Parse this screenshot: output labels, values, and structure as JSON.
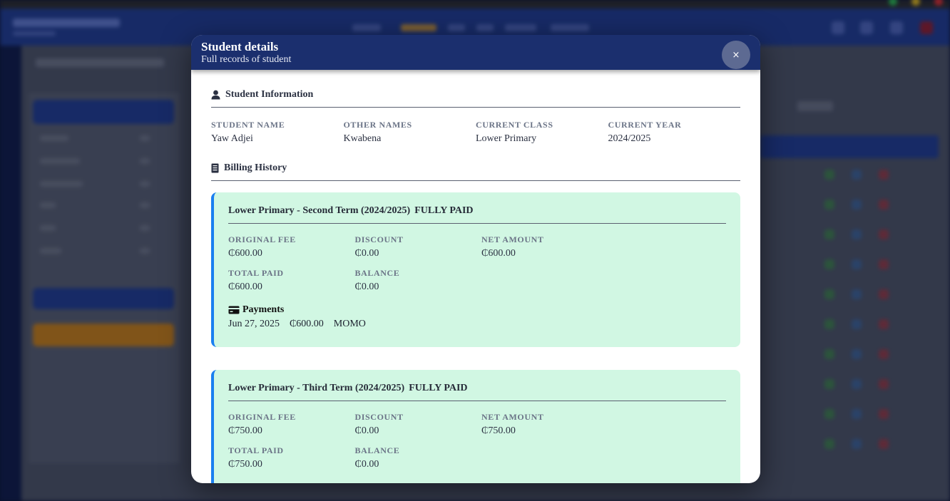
{
  "modal": {
    "title": "Student details",
    "subtitle": "Full records of student",
    "close_label": "×"
  },
  "student_info": {
    "heading": "Student Information",
    "fields": [
      {
        "label": "STUDENT NAME",
        "value": "Yaw Adjei"
      },
      {
        "label": "OTHER NAMES",
        "value": "Kwabena"
      },
      {
        "label": "CURRENT CLASS",
        "value": "Lower Primary"
      },
      {
        "label": "CURRENT YEAR",
        "value": "2024/2025"
      }
    ]
  },
  "billing": {
    "heading": "Billing History",
    "records": [
      {
        "title": "Lower Primary - Second Term (2024/2025)",
        "status": "FULLY PAID",
        "fields": [
          {
            "label": "ORIGINAL FEE",
            "value": "₵600.00"
          },
          {
            "label": "DISCOUNT",
            "value": "₵0.00"
          },
          {
            "label": "NET AMOUNT",
            "value": "₵600.00"
          },
          {
            "label": "TOTAL PAID",
            "value": "₵600.00"
          },
          {
            "label": "BALANCE",
            "value": "₵0.00"
          }
        ],
        "payments_heading": "Payments",
        "payments": [
          {
            "date": "Jun 27, 2025",
            "amount": "₵600.00",
            "method": "MOMO"
          }
        ]
      },
      {
        "title": "Lower Primary - Third Term (2024/2025)",
        "status": "FULLY PAID",
        "fields": [
          {
            "label": "ORIGINAL FEE",
            "value": "₵750.00"
          },
          {
            "label": "DISCOUNT",
            "value": "₵0.00"
          },
          {
            "label": "NET AMOUNT",
            "value": "₵750.00"
          },
          {
            "label": "TOTAL PAID",
            "value": "₵750.00"
          },
          {
            "label": "BALANCE",
            "value": "₵0.00"
          }
        ]
      }
    ]
  },
  "colors": {
    "header_navy": "#1b2f6e",
    "card_green": "#d1f7e3",
    "card_accent_blue": "#1a7ff0",
    "orange_button": "#c17a14"
  },
  "icons": {
    "student_section": "person-icon",
    "billing_section": "receipt-icon",
    "payments": "credit-card-icon"
  }
}
